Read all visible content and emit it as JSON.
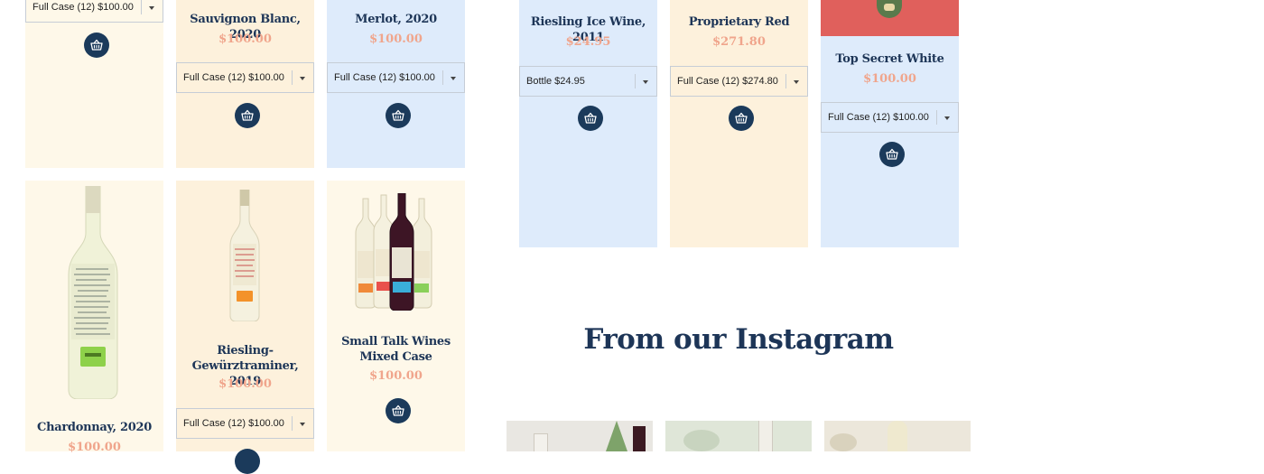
{
  "products": [
    {
      "id": "p0",
      "title": "",
      "price": "",
      "select": "Full Case (12) $100.00"
    },
    {
      "id": "p1",
      "title": "Sauvignon Blanc, 2020",
      "price": "$100.00",
      "select": "Full Case (12) $100.00"
    },
    {
      "id": "p2",
      "title": "Merlot, 2020",
      "price": "$100.00",
      "select": "Full Case (12) $100.00"
    },
    {
      "id": "p3",
      "title": "Riesling Ice Wine, 2011",
      "price": "$24.95",
      "select": "Bottle $24.95"
    },
    {
      "id": "p4",
      "title": "Proprietary Red",
      "price": "$271.80",
      "select": "Full Case (12) $274.80"
    },
    {
      "id": "p5",
      "title": "Top Secret White",
      "price": "$100.00",
      "select": "Full Case (12) $100.00"
    },
    {
      "id": "p6",
      "title": "Chardonnay, 2020",
      "price": "$100.00",
      "select": ""
    },
    {
      "id": "p7",
      "title": "Riesling-Gewürztraminer, 2019",
      "price": "$100.00",
      "select": "Full Case (12) $100.00"
    },
    {
      "id": "p8",
      "title": "Small Talk Wines Mixed Case",
      "price": "$100.00",
      "select": ""
    }
  ],
  "instagram": {
    "heading": "From our Instagram"
  },
  "icons": {
    "cart": "basket-icon",
    "dropdown": "chevron-down-icon"
  },
  "colors": {
    "navy": "#1b3a5b",
    "price": "#f0a58c",
    "cream": "#fef8e9",
    "peach": "#fdf1dc",
    "blue": "#deebfb"
  }
}
